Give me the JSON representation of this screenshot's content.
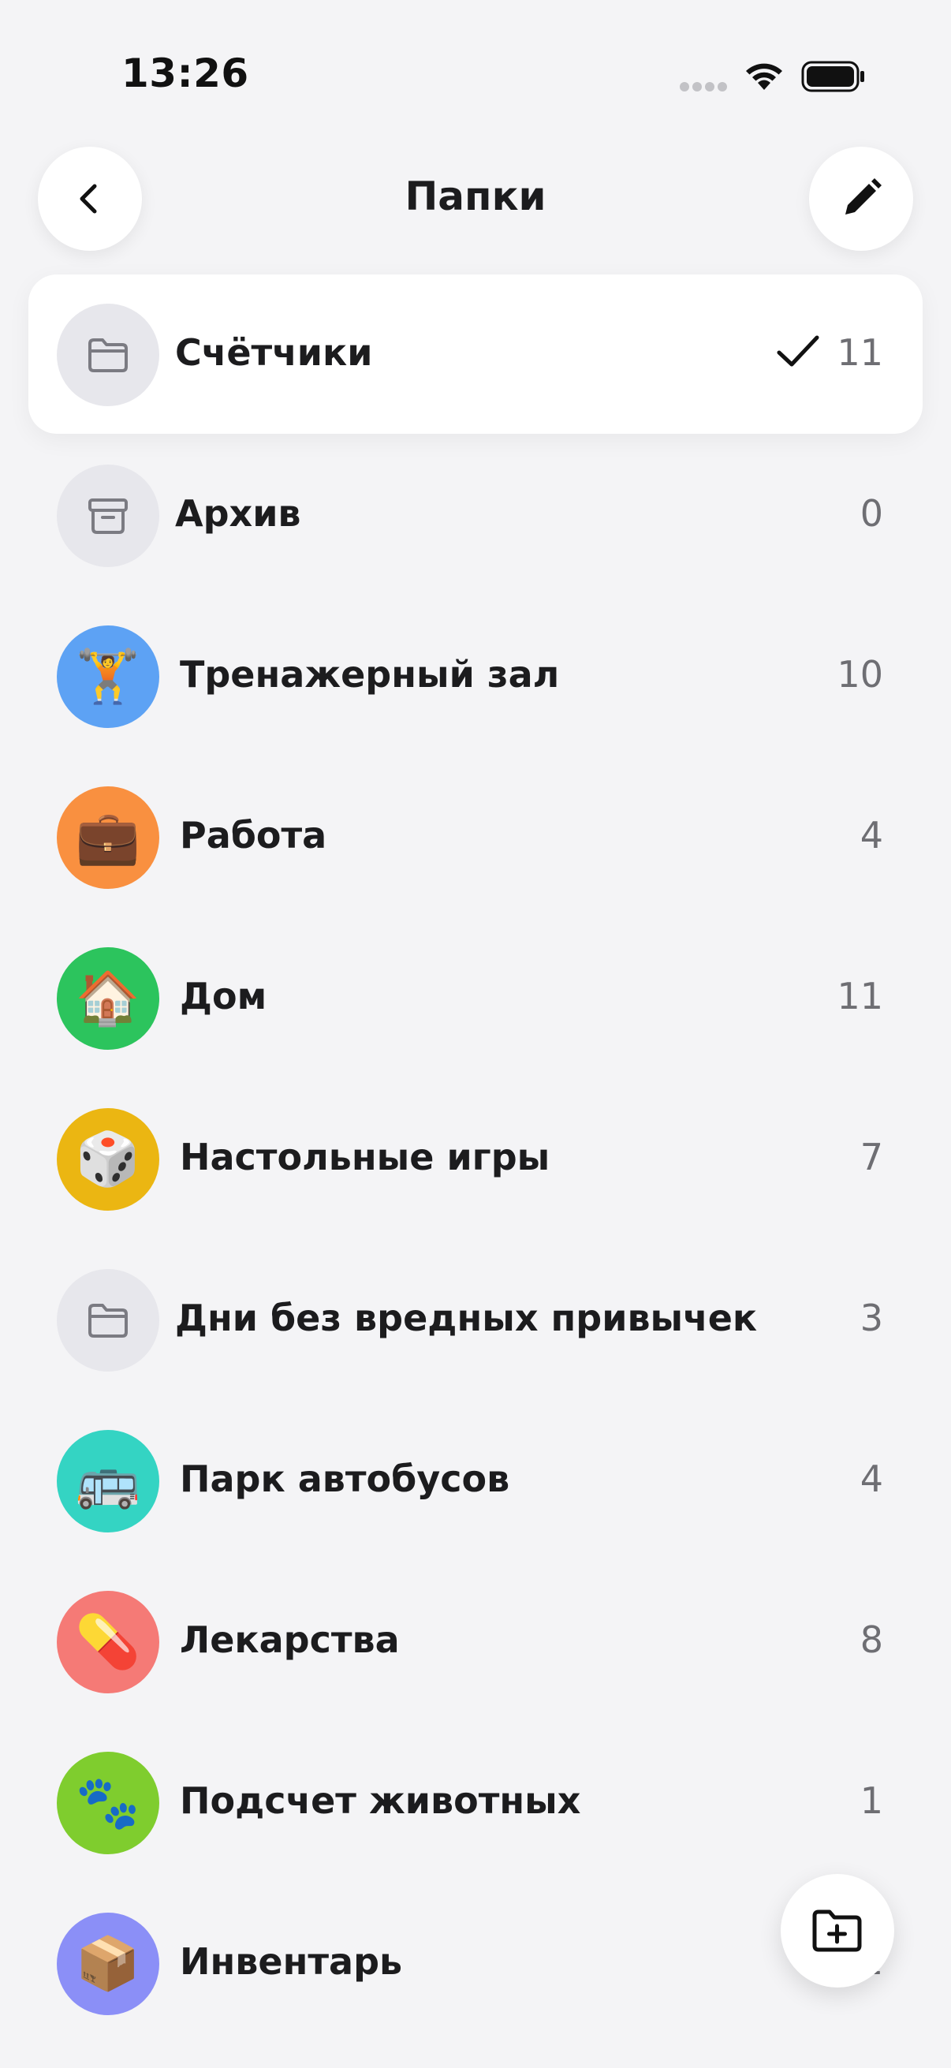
{
  "status_bar": {
    "time": "13:26"
  },
  "nav": {
    "title": "Папки",
    "back_icon": "chevron-left-icon",
    "edit_icon": "pencil-icon"
  },
  "folders": [
    {
      "name": "Счётчики",
      "count": "11",
      "icon": "folder-icon",
      "icon_bg": "#e7e7ec",
      "selected": true
    },
    {
      "name": "Архив",
      "count": "0",
      "icon": "archive-box-icon",
      "icon_bg": "#e7e7ec",
      "selected": false
    },
    {
      "name": "Тренажерный зал",
      "count": "10",
      "icon": "🏋️",
      "icon_bg": "#5da2f4",
      "selected": false
    },
    {
      "name": "Работа",
      "count": "4",
      "icon": "💼",
      "icon_bg": "#f99040",
      "selected": false
    },
    {
      "name": "Дом",
      "count": "11",
      "icon": "🏠",
      "icon_bg": "#2cc45d",
      "selected": false
    },
    {
      "name": "Настольные игры",
      "count": "7",
      "icon": "🎲",
      "icon_bg": "#ebb612",
      "selected": false
    },
    {
      "name": "Дни без вредных привычек",
      "count": "3",
      "icon": "folder-icon",
      "icon_bg": "#e7e7ec",
      "selected": false
    },
    {
      "name": "Парк автобусов",
      "count": "4",
      "icon": "🚌",
      "icon_bg": "#34d4c3",
      "selected": false
    },
    {
      "name": "Лекарства",
      "count": "8",
      "icon": "💊",
      "icon_bg": "#f57a76",
      "selected": false
    },
    {
      "name": "Подсчет животных",
      "count": "1",
      "icon": "🐾",
      "icon_bg": "#7fcd2e",
      "selected": false
    },
    {
      "name": "Инвентарь",
      "count": "1",
      "icon": "📦",
      "icon_bg": "#8b8ff7",
      "selected": false
    }
  ],
  "fab": {
    "icon": "folder-plus-icon"
  }
}
